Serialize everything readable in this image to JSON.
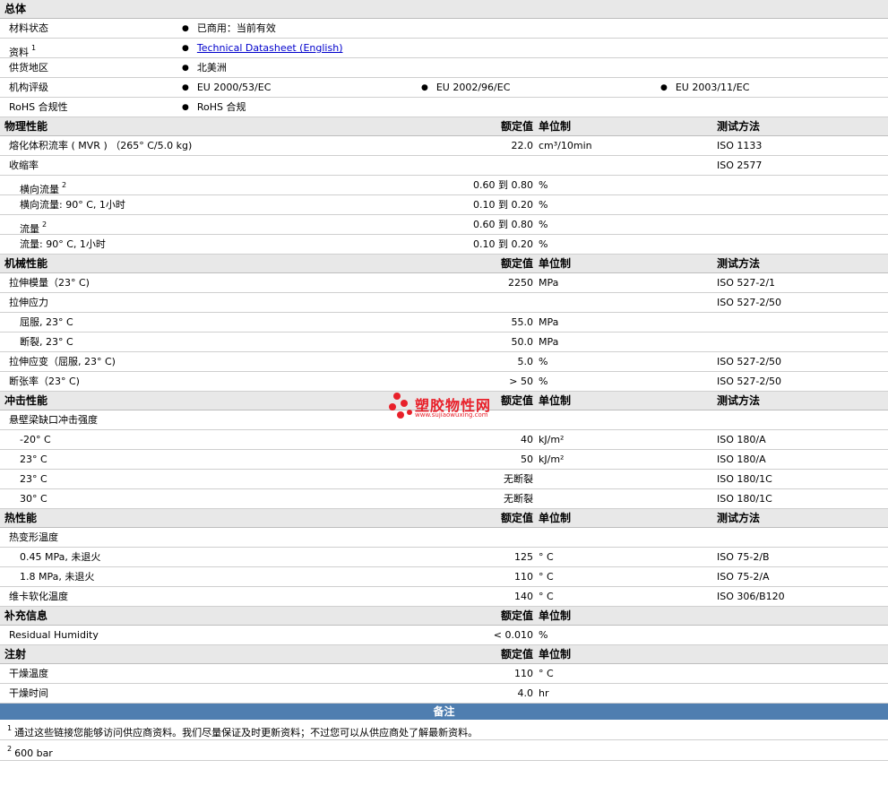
{
  "general": {
    "title": "总体",
    "material_status_label": "材料状态",
    "material_status_value": "已商用：当前有效",
    "literature_label": "资料",
    "literature_sup": "1",
    "literature_link": "Technical Datasheet (English)",
    "region_label": "供货地区",
    "region_value": "北美洲",
    "agency_label": "机构评级",
    "agency_values": [
      "EU 2000/53/EC",
      "EU 2002/96/EC",
      "EU 2003/11/EC"
    ],
    "rohs_label": "RoHS 合规性",
    "rohs_value": "RoHS 合规"
  },
  "column_headers": {
    "value": "额定值",
    "unit": "单位制",
    "method": "测试方法"
  },
  "physical": {
    "title": "物理性能",
    "rows": [
      {
        "label": "熔化体积流率 ( MVR ) （265° C/5.0 kg)",
        "value": "22.0",
        "unit": "cm³/10min",
        "method": "ISO 1133"
      },
      {
        "label": "收缩率",
        "value": "",
        "unit": "",
        "method": "ISO 2577"
      },
      {
        "label": "横向流量",
        "sup": "2",
        "value": "0.60 到 0.80",
        "unit": "%",
        "method": ""
      },
      {
        "label": "横向流量: 90° C, 1小时",
        "value": "0.10 到 0.20",
        "unit": "%",
        "method": ""
      },
      {
        "label": "流量",
        "sup": "2",
        "value": "0.60 到 0.80",
        "unit": "%",
        "method": ""
      },
      {
        "label": "流量: 90° C, 1小时",
        "value": "0.10 到 0.20",
        "unit": "%",
        "method": ""
      }
    ]
  },
  "mechanical": {
    "title": "机械性能",
    "rows": [
      {
        "label": "拉伸模量（23° C)",
        "value": "2250",
        "unit": "MPa",
        "method": "ISO 527-2/1"
      },
      {
        "label": "拉伸应力",
        "value": "",
        "unit": "",
        "method": "ISO 527-2/50"
      },
      {
        "label": "屈服, 23° C",
        "value": "55.0",
        "unit": "MPa",
        "method": ""
      },
      {
        "label": "断裂, 23° C",
        "value": "50.0",
        "unit": "MPa",
        "method": ""
      },
      {
        "label": "拉伸应变（屈服, 23° C)",
        "value": "5.0",
        "unit": "%",
        "method": "ISO 527-2/50"
      },
      {
        "label": "断张率（23° C)",
        "value": "> 50",
        "unit": "%",
        "method": "ISO 527-2/50"
      }
    ]
  },
  "impact": {
    "title": "冲击性能",
    "rows": [
      {
        "label": "悬壁梁缺口冲击强度",
        "value": "",
        "unit": "",
        "method": ""
      },
      {
        "label": "-20° C",
        "value": "40",
        "unit": "kJ/m²",
        "method": "ISO 180/A"
      },
      {
        "label": "23° C",
        "value": "50",
        "unit": "kJ/m²",
        "method": "ISO 180/A"
      },
      {
        "label": "23° C",
        "value": "无断裂",
        "unit": "",
        "method": "ISO 180/1C"
      },
      {
        "label": "30° C",
        "value": "无断裂",
        "unit": "",
        "method": "ISO 180/1C"
      }
    ]
  },
  "thermal": {
    "title": "热性能",
    "rows": [
      {
        "label": "热变形温度",
        "value": "",
        "unit": "",
        "method": ""
      },
      {
        "label": "0.45 MPa, 未退火",
        "value": "125",
        "unit": "° C",
        "method": "ISO 75-2/B"
      },
      {
        "label": "1.8 MPa, 未退火",
        "value": "110",
        "unit": "° C",
        "method": "ISO 75-2/A"
      },
      {
        "label": "维卡软化温度",
        "value": "140",
        "unit": "° C",
        "method": "ISO 306/B120"
      }
    ]
  },
  "supplemental": {
    "title": "补充信息",
    "rows": [
      {
        "label": "Residual Humidity",
        "value": "< 0.010",
        "unit": "%",
        "method": ""
      }
    ]
  },
  "injection": {
    "title": "注射",
    "rows": [
      {
        "label": "干燥温度",
        "value": "110",
        "unit": "° C",
        "method": ""
      },
      {
        "label": "干燥时间",
        "value": "4.0",
        "unit": "hr",
        "method": ""
      }
    ]
  },
  "notes": {
    "title": "备注",
    "items": [
      {
        "num": "1",
        "text": "通过这些链接您能够访问供应商资料。我们尽量保证及时更新资料；不过您可以从供应商处了解最新资料。"
      },
      {
        "num": "2",
        "text": "600 bar"
      }
    ]
  },
  "watermark": {
    "text": "塑胶物性网",
    "url": "www.sujiaowuxing.com",
    "color": "#e8202a"
  }
}
